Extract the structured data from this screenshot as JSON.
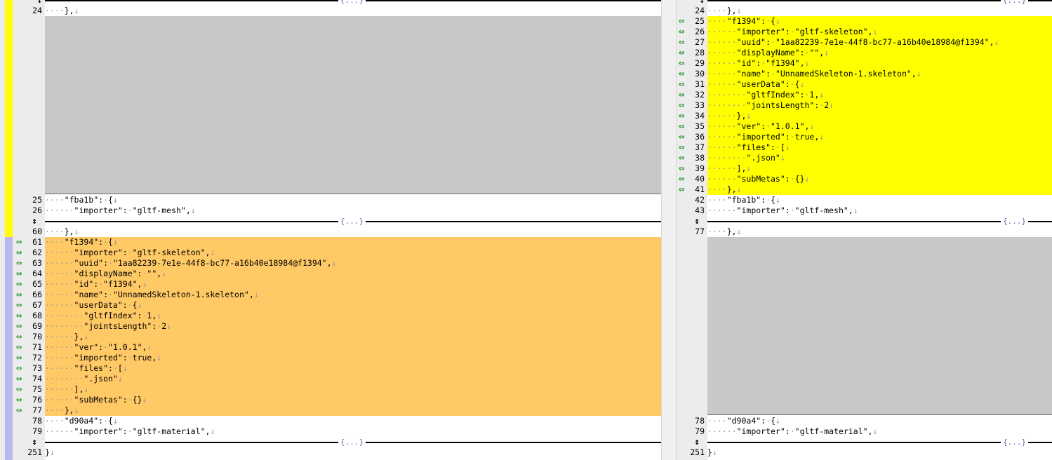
{
  "colors": {
    "left_change": "#ffc966",
    "right_change": "#ffff00",
    "gap": "#c8c8c8",
    "marker": "#2a9a2a"
  },
  "fold_label": "{...}",
  "left": {
    "lines": [
      {
        "type": "fold_top"
      },
      {
        "type": "code",
        "ln": "24",
        "text": "····},↓"
      },
      {
        "type": "gap",
        "rows": 17
      },
      {
        "type": "code",
        "ln": "25",
        "text": "····\"fba1b\":·{↓"
      },
      {
        "type": "code",
        "ln": "26",
        "text": "······\"importer\":·\"gltf-mesh\",↓"
      },
      {
        "type": "fold",
        "icon": "↕"
      },
      {
        "type": "code",
        "ln": "60",
        "text": "····},↓"
      },
      {
        "type": "code",
        "ln": "61",
        "text": "····\"f1394\":·{↓",
        "changed": true
      },
      {
        "type": "code",
        "ln": "62",
        "text": "······\"importer\":·\"gltf-skeleton\",↓",
        "changed": true
      },
      {
        "type": "code",
        "ln": "63",
        "text": "······\"uuid\":·\"1aa82239-7e1e-44f8-bc77-a16b40e18984@f1394\",↓",
        "changed": true
      },
      {
        "type": "code",
        "ln": "64",
        "text": "······\"displayName\":·\"\",↓",
        "changed": true
      },
      {
        "type": "code",
        "ln": "65",
        "text": "······\"id\":·\"f1394\",↓",
        "changed": true
      },
      {
        "type": "code",
        "ln": "66",
        "text": "······\"name\":·\"UnnamedSkeleton-1.skeleton\",↓",
        "changed": true
      },
      {
        "type": "code",
        "ln": "67",
        "text": "······\"userData\":·{↓",
        "changed": true
      },
      {
        "type": "code",
        "ln": "68",
        "text": "········\"gltfIndex\":·1,↓",
        "changed": true
      },
      {
        "type": "code",
        "ln": "69",
        "text": "········\"jointsLength\":·2↓",
        "changed": true
      },
      {
        "type": "code",
        "ln": "70",
        "text": "······},↓",
        "changed": true
      },
      {
        "type": "code",
        "ln": "71",
        "text": "······\"ver\":·\"1.0.1\",↓",
        "changed": true
      },
      {
        "type": "code",
        "ln": "72",
        "text": "······\"imported\":·true,↓",
        "changed": true
      },
      {
        "type": "code",
        "ln": "73",
        "text": "······\"files\":·[↓",
        "changed": true
      },
      {
        "type": "code",
        "ln": "74",
        "text": "········\".json\"↓",
        "changed": true
      },
      {
        "type": "code",
        "ln": "75",
        "text": "······],↓",
        "changed": true
      },
      {
        "type": "code",
        "ln": "76",
        "text": "······\"subMetas\":·{}↓",
        "changed": true
      },
      {
        "type": "code",
        "ln": "77",
        "text": "····},↓",
        "changed": true
      },
      {
        "type": "code",
        "ln": "78",
        "text": "····\"d90a4\":·{↓"
      },
      {
        "type": "code",
        "ln": "79",
        "text": "······\"importer\":·\"gltf-material\",↓"
      },
      {
        "type": "fold",
        "icon": "↕"
      },
      {
        "type": "code",
        "ln": "251",
        "text": "}↓"
      }
    ]
  },
  "right": {
    "lines": [
      {
        "type": "fold_top"
      },
      {
        "type": "code",
        "ln": "24",
        "text": "····},↓"
      },
      {
        "type": "code",
        "ln": "25",
        "text": "····\"f1394\":·{↓",
        "changed": true
      },
      {
        "type": "code",
        "ln": "26",
        "text": "······\"importer\":·\"gltf-skeleton\",↓",
        "changed": true
      },
      {
        "type": "code",
        "ln": "27",
        "text": "······\"uuid\":·\"1aa82239-7e1e-44f8-bc77-a16b40e18984@f1394\",↓",
        "changed": true
      },
      {
        "type": "code",
        "ln": "28",
        "text": "······\"displayName\":·\"\",↓",
        "changed": true
      },
      {
        "type": "code",
        "ln": "29",
        "text": "······\"id\":·\"f1394\",↓",
        "changed": true
      },
      {
        "type": "code",
        "ln": "30",
        "text": "······\"name\":·\"UnnamedSkeleton-1.skeleton\",↓",
        "changed": true
      },
      {
        "type": "code",
        "ln": "31",
        "text": "······\"userData\":·{↓",
        "changed": true
      },
      {
        "type": "code",
        "ln": "32",
        "text": "········\"gltfIndex\":·1,↓",
        "changed": true
      },
      {
        "type": "code",
        "ln": "33",
        "text": "········\"jointsLength\":·2↓",
        "changed": true
      },
      {
        "type": "code",
        "ln": "34",
        "text": "······},↓",
        "changed": true
      },
      {
        "type": "code",
        "ln": "35",
        "text": "······\"ver\":·\"1.0.1\",↓",
        "changed": true
      },
      {
        "type": "code",
        "ln": "36",
        "text": "······\"imported\":·true,↓",
        "changed": true
      },
      {
        "type": "code",
        "ln": "37",
        "text": "······\"files\":·[↓",
        "changed": true
      },
      {
        "type": "code",
        "ln": "38",
        "text": "········\".json\"↓",
        "changed": true
      },
      {
        "type": "code",
        "ln": "39",
        "text": "······],↓",
        "changed": true
      },
      {
        "type": "code",
        "ln": "40",
        "text": "······\"subMetas\":·{}↓",
        "changed": true
      },
      {
        "type": "code",
        "ln": "41",
        "text": "····},↓",
        "changed": true
      },
      {
        "type": "code",
        "ln": "42",
        "text": "····\"fba1b\":·{↓"
      },
      {
        "type": "code",
        "ln": "43",
        "text": "······\"importer\":·\"gltf-mesh\",↓"
      },
      {
        "type": "fold",
        "icon": "↕"
      },
      {
        "type": "code",
        "ln": "77",
        "text": "····},↓"
      },
      {
        "type": "gap",
        "rows": 17
      },
      {
        "type": "code",
        "ln": "78",
        "text": "····\"d90a4\":·{↓"
      },
      {
        "type": "code",
        "ln": "79",
        "text": "······\"importer\":·\"gltf-material\",↓"
      },
      {
        "type": "fold",
        "icon": "↕"
      },
      {
        "type": "code",
        "ln": "251",
        "text": "}↓"
      }
    ]
  }
}
